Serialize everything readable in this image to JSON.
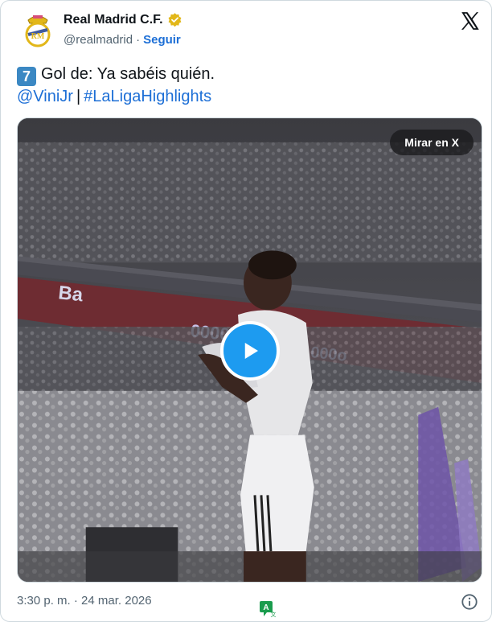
{
  "account": {
    "name": "Real Madrid C.F.",
    "handle": "@realmadrid",
    "separator": "·",
    "follow_label": "Seguir"
  },
  "tweet": {
    "emoji": "7",
    "text": "Gol de: Ya sabéis quién.",
    "mention": "@ViniJr",
    "divider": "|",
    "hashtag": "#LaLigaHighlights"
  },
  "media": {
    "watch_label": "Mirar en X"
  },
  "footer": {
    "timestamp": "3:30 p. m. · 24 mar. 2026"
  },
  "colors": {
    "link": "#1d6fd6",
    "play": "#1d9bf0",
    "verified": "#e2b719"
  },
  "icons": {
    "logo": "x-logo-icon",
    "verified": "verified-badge-icon",
    "play": "play-icon",
    "info": "info-icon",
    "translate": "translate-icon"
  }
}
